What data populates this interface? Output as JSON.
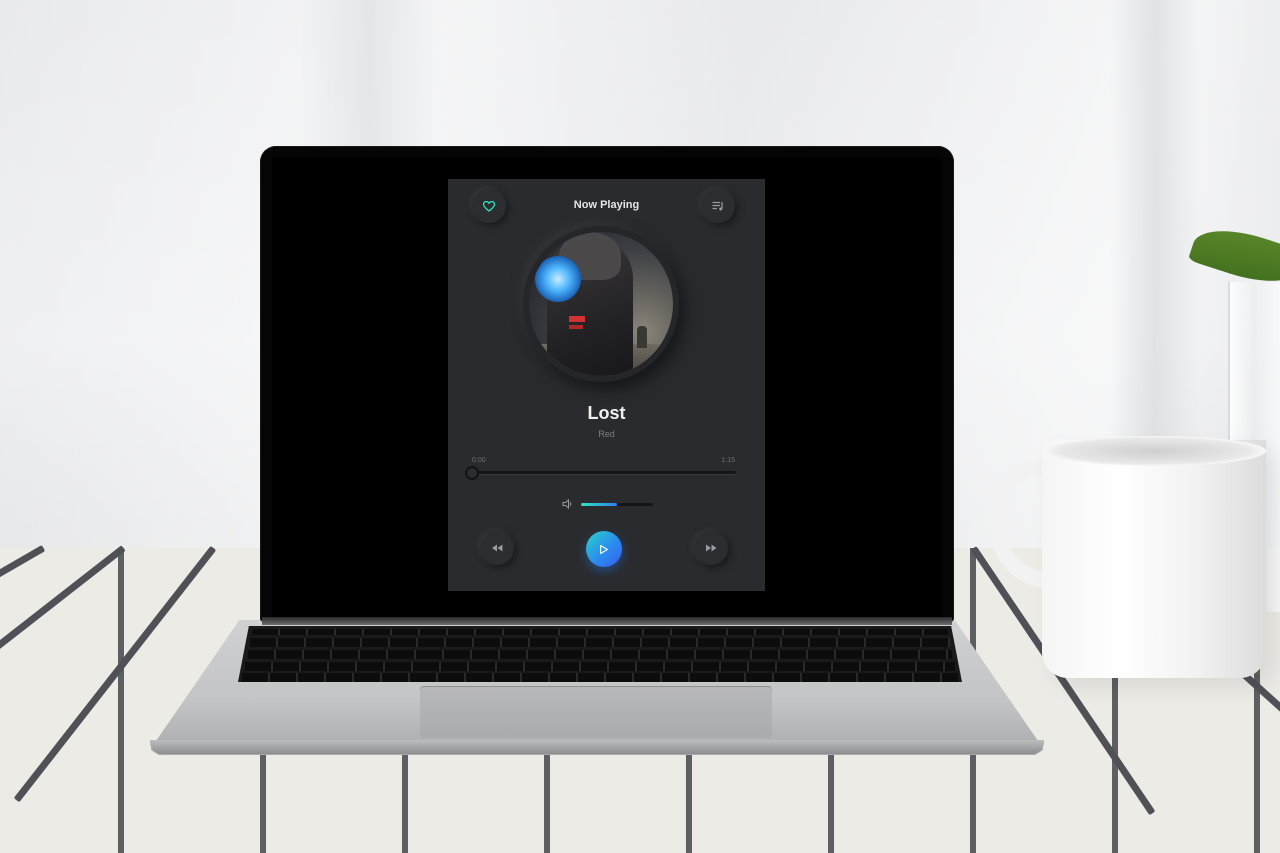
{
  "player": {
    "header_title": "Now Playing",
    "song_title": "Lost",
    "artist": "Red",
    "elapsed_time": "0:00",
    "total_time": "1:15",
    "progress_fraction": 0.0,
    "volume_fraction": 0.5,
    "icons": {
      "favorite": "heart-icon",
      "playlist": "playlist-icon",
      "volume": "volume-icon",
      "rewind": "rewind-icon",
      "play": "play-icon",
      "fast_forward": "fast-forward-icon"
    },
    "colors": {
      "accent": "#2de2c0",
      "play_gradient_start": "#2bd3c8",
      "play_gradient_end": "#3a5cf0",
      "background": "#2a2b2e"
    }
  }
}
